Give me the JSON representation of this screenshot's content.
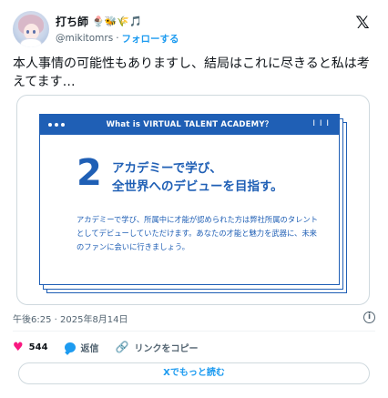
{
  "user": {
    "display_name": "打ち師",
    "emojis": "🍨🐝🌾🎵",
    "handle": "@mikitomrs",
    "separator": "·",
    "follow_label": "フォローする"
  },
  "tweet": {
    "text": "本人事情の可能性もありますし、結局はこれに尽きると私は考えてます…",
    "timestamp": "午後6:25 · 2025年8月14日"
  },
  "media": {
    "bar_title": "What is VIRTUAL TALENT ACADEMY？",
    "bar_marks": "I I I",
    "number": "2",
    "headline_line1": "アカデミーで学び、",
    "headline_line2": "全世界へのデビューを目指す。",
    "body": "アカデミーで学び、所属中に才能が認められた方は弊社所属のタレントとしてデビューしていただけます。あなたの才能と魅力を武器に、未来のファンに会いに行きましょう。"
  },
  "actions": {
    "like_count": "544",
    "reply_label": "返信",
    "copy_link_label": "リンクをコピー"
  },
  "read_more_label": "Xでもっと読む",
  "icons": {
    "logo": "x-logo-icon",
    "like": "heart-icon",
    "reply": "reply-bubble-icon",
    "copy": "link-icon",
    "info": "info-icon"
  },
  "colors": {
    "accent": "#1d9bf0",
    "like": "#f91880",
    "card_blue": "#1f5fb5"
  }
}
